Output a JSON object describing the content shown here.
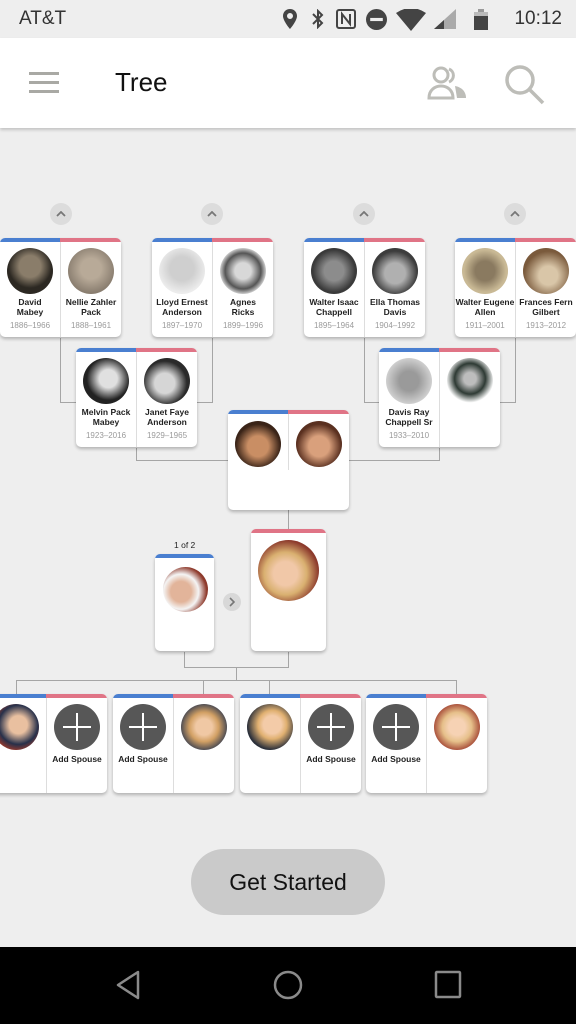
{
  "status_bar": {
    "carrier": "AT&T",
    "time": "10:12",
    "icons": [
      "location-icon",
      "bluetooth-icon",
      "nfc-icon",
      "do-not-disturb-icon",
      "wifi-icon",
      "signal-icon",
      "battery-icon"
    ]
  },
  "app_bar": {
    "title": "Tree",
    "menu_icon": "hamburger-menu-icon",
    "actions": [
      "people-icon",
      "search-icon"
    ]
  },
  "tree": {
    "great_grandparents": [
      {
        "father": {
          "name": "David Mabey",
          "line1": "David",
          "line2": "Mabey",
          "dates": "1886–1966"
        },
        "mother": {
          "name": "Nellie Zahler Pack",
          "line1": "Nellie Zahler",
          "line2": "Pack",
          "dates": "1888–1961"
        }
      },
      {
        "father": {
          "name": "Lloyd Ernest Anderson",
          "line1": "Lloyd Ernest",
          "line2": "Anderson",
          "dates": "1897–1970"
        },
        "mother": {
          "name": "Agnes Ricks",
          "line1": "Agnes",
          "line2": "Ricks",
          "dates": "1899–1996"
        }
      },
      {
        "father": {
          "name": "Walter Isaac Chappell",
          "line1": "Walter Isaac",
          "line2": "Chappell",
          "dates": "1895–1964"
        },
        "mother": {
          "name": "Ella Thomas Davis",
          "line1": "Ella Thomas",
          "line2": "Davis",
          "dates": "1904–1992"
        }
      },
      {
        "father": {
          "name": "Walter Eugene Allen",
          "line1": "Walter Eugene",
          "line2": "Allen",
          "dates": "1911–2001"
        },
        "mother": {
          "name": "Frances Fern Gilbert",
          "line1": "Frances Fern",
          "line2": "Gilbert",
          "dates": "1913–2012"
        }
      }
    ],
    "grandparents": [
      {
        "father": {
          "name": "Melvin Pack Mabey",
          "line1": "Melvin Pack",
          "line2": "Mabey",
          "dates": "1923–2016"
        },
        "mother": {
          "name": "Janet Faye Anderson",
          "line1": "Janet Faye",
          "line2": "Anderson",
          "dates": "1929–1965"
        }
      },
      {
        "father": {
          "name": "Davis Ray Chappell Sr",
          "line1": "Davis Ray",
          "line2": "Chappell Sr",
          "dates": "1933–2010"
        },
        "mother": {
          "name": "",
          "line1": "",
          "line2": "",
          "dates": ""
        }
      }
    ],
    "parents": {
      "father": {
        "name": ""
      },
      "mother": {
        "name": ""
      }
    },
    "spouse_pager": "1 of 2",
    "add_spouse_label": "Add Spouse",
    "children_count": 4
  },
  "colors": {
    "male": "#4a7fd0",
    "female": "#e07486",
    "background": "#eeeeee"
  },
  "cta": {
    "label": "Get Started"
  },
  "nav_bar": [
    "back-icon",
    "home-icon",
    "recents-icon"
  ]
}
